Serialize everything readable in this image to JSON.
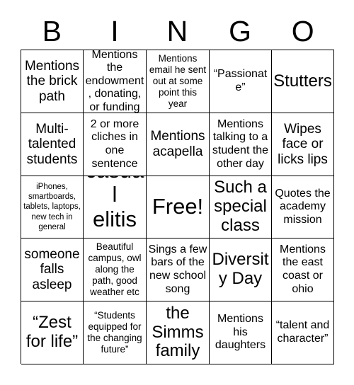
{
  "card": {
    "title_letters": [
      "B",
      "I",
      "N",
      "G",
      "O"
    ],
    "columns": 5,
    "rows": 5,
    "border_color": "#000000",
    "background_color": "#ffffff",
    "text_color": "#000000",
    "free_space": {
      "row": 3,
      "column": 3,
      "label": "Free!"
    },
    "cells": [
      {
        "row": 1,
        "col": 1,
        "text": "Mentions the brick path",
        "size": "lg"
      },
      {
        "row": 1,
        "col": 2,
        "text": "Mentions the endowment, donating, or funding",
        "size": "md"
      },
      {
        "row": 1,
        "col": 3,
        "text": "Mentions email he sent out at some point this year",
        "size": "sm"
      },
      {
        "row": 1,
        "col": 4,
        "text": "“Passionate”",
        "size": "md"
      },
      {
        "row": 1,
        "col": 5,
        "text": "Stutters",
        "size": "xl"
      },
      {
        "row": 2,
        "col": 1,
        "text": "Multi-talented students",
        "size": "lg"
      },
      {
        "row": 2,
        "col": 2,
        "text": "2 or more cliches in one sentence",
        "size": "md"
      },
      {
        "row": 2,
        "col": 3,
        "text": "Mentions acapella",
        "size": "lg"
      },
      {
        "row": 2,
        "col": 4,
        "text": "Mentions talking to a student the other day",
        "size": "md"
      },
      {
        "row": 2,
        "col": 5,
        "text": "Wipes face or licks lips",
        "size": "lg"
      },
      {
        "row": 3,
        "col": 1,
        "text": "iPhones, smartboards, tablets, laptops, new tech in general",
        "size": "xs"
      },
      {
        "row": 3,
        "col": 2,
        "text": "casual elitism",
        "size": "xxl"
      },
      {
        "row": 3,
        "col": 3,
        "text": "Free!",
        "size": "xxl"
      },
      {
        "row": 3,
        "col": 4,
        "text": "Such a special class",
        "size": "xl"
      },
      {
        "row": 3,
        "col": 5,
        "text": "Quotes the academy mission",
        "size": "md"
      },
      {
        "row": 4,
        "col": 1,
        "text": "someone falls asleep",
        "size": "lg"
      },
      {
        "row": 4,
        "col": 2,
        "text": "Beautiful campus, owl along the path, good weather etc",
        "size": "sm"
      },
      {
        "row": 4,
        "col": 3,
        "text": "Sings a few bars of the new school song",
        "size": "md"
      },
      {
        "row": 4,
        "col": 4,
        "text": "Diversity Day",
        "size": "xl"
      },
      {
        "row": 4,
        "col": 5,
        "text": "Mentions the east coast or ohio",
        "size": "md"
      },
      {
        "row": 5,
        "col": 1,
        "text": "“Zest for life”",
        "size": "xl"
      },
      {
        "row": 5,
        "col": 2,
        "text": "“Students equipped for the changing future”",
        "size": "sm"
      },
      {
        "row": 5,
        "col": 3,
        "text": "the Simms family",
        "size": "xl"
      },
      {
        "row": 5,
        "col": 4,
        "text": "Mentions his daughters",
        "size": "md"
      },
      {
        "row": 5,
        "col": 5,
        "text": "“talent and character”",
        "size": "md"
      }
    ]
  }
}
